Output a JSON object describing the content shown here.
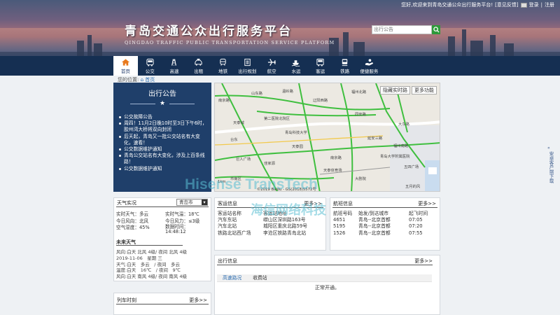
{
  "topbar": {
    "greeting": "您好,欢迎来到青岛交通公众出行服务平台!",
    "feedback": "[意见反馈]",
    "login": "登录",
    "sep": "|",
    "register": "注册"
  },
  "brand": {
    "title": "青岛交通公众出行服务平台",
    "subtitle": "QINGDAO TRAFFIC PUBLIC TRANSPORTATION SERVICE PLATFORM"
  },
  "search": {
    "placeholder": "出行公告"
  },
  "nav": [
    {
      "label": "首页",
      "icon": "home-icon",
      "active": true
    },
    {
      "label": "公交",
      "icon": "bus-icon"
    },
    {
      "label": "高速",
      "icon": "highway-icon"
    },
    {
      "label": "出租",
      "icon": "taxi-icon"
    },
    {
      "label": "地铁",
      "icon": "subway-icon"
    },
    {
      "label": "出行规划",
      "icon": "plan-icon"
    },
    {
      "label": "航空",
      "icon": "plane-icon"
    },
    {
      "label": "水运",
      "icon": "ship-icon"
    },
    {
      "label": "客运",
      "icon": "coach-icon"
    },
    {
      "label": "铁路",
      "icon": "train-icon"
    },
    {
      "label": "便捷服务",
      "icon": "service-icon"
    }
  ],
  "breadcrumb": {
    "prefix": "您的位置:",
    "home": "首页"
  },
  "notice": {
    "title": "出行公告",
    "items": [
      "公交故障公告",
      "周四！11月2日晚10时至3日下午6时，胶州湾大桥将双向封闭",
      "后天起，青岛又一批公交站名有大变化，速看！",
      "公交数据维护通知",
      "青岛公交站名有大变化，涉及上百条线路！",
      "公交数据维护通知"
    ]
  },
  "map": {
    "btn_traffic": "隐藏实时路",
    "btn_more": "更多功能",
    "labels": [
      "南京路",
      "山东路",
      "温岭路",
      "福州北路",
      "辽阳西路",
      "第二医院北院区",
      "天泰城",
      "同安路",
      "青岛科技大学",
      "天泰园",
      "台东",
      "大东路",
      "市南区",
      "佳家源",
      "大剧院",
      "南京路",
      "五四广场",
      "延安三路",
      "青岛大学附属医院",
      "福州南路",
      "五月的风",
      "天泰体育场",
      "巨人广场"
    ],
    "scale": "1km",
    "copyright": "©2019 Baidu - GS(2018)5572号"
  },
  "weather": {
    "title": "天气实况",
    "city": "青岛市",
    "live": [
      [
        "实时天气：多云",
        "实时气温：18℃"
      ],
      [
        "今日风向：北风",
        "今日风力：≤3级"
      ],
      [
        "空气湿度：45%",
        "数据时间：14:48:12"
      ]
    ],
    "future_title": "未来天气",
    "future": [
      "风向:白天 北风 4级/ 夜间 北风 4级",
      "2019-11-06　星期 三",
      "天气:白天　多云　/ 夜间　多云",
      "温度:白天　16℃　/ 夜间　9℃",
      "风向:白天 南风 4级/ 夜间 南风 4级"
    ]
  },
  "coach": {
    "title": "客运信息",
    "more": "更多>>",
    "headers": [
      "客运站名称",
      "客运站地址"
    ],
    "rows": [
      [
        "汽车东站",
        "崂山区深圳路163号"
      ],
      [
        "汽车北站",
        "城阳区重庆北路59号"
      ],
      [
        "铁路北站西广场",
        "李沧区铁路青岛北站"
      ]
    ]
  },
  "flight": {
    "title": "航班信息",
    "more": "更多>>",
    "headers": [
      "航班号码",
      "始发/到达城市",
      "起飞时间"
    ],
    "rows": [
      [
        "4651",
        "青岛--北京首都",
        "07:05"
      ],
      [
        "5195",
        "青岛--北京首都",
        "07:20"
      ],
      [
        "1526",
        "青岛--北京首都",
        "07:55"
      ]
    ]
  },
  "travel": {
    "title": "出行信息",
    "more": "更多>>",
    "tabs": [
      "高速路况",
      "收费站"
    ],
    "status": "正常开通。"
  },
  "train": {
    "title": "列车时刻",
    "more": "更多>>"
  },
  "sidebar": {
    "text": "安卓客户端下载"
  },
  "watermark": {
    "brand": "Hisense TransTech",
    "cn": "海信网络科技"
  }
}
